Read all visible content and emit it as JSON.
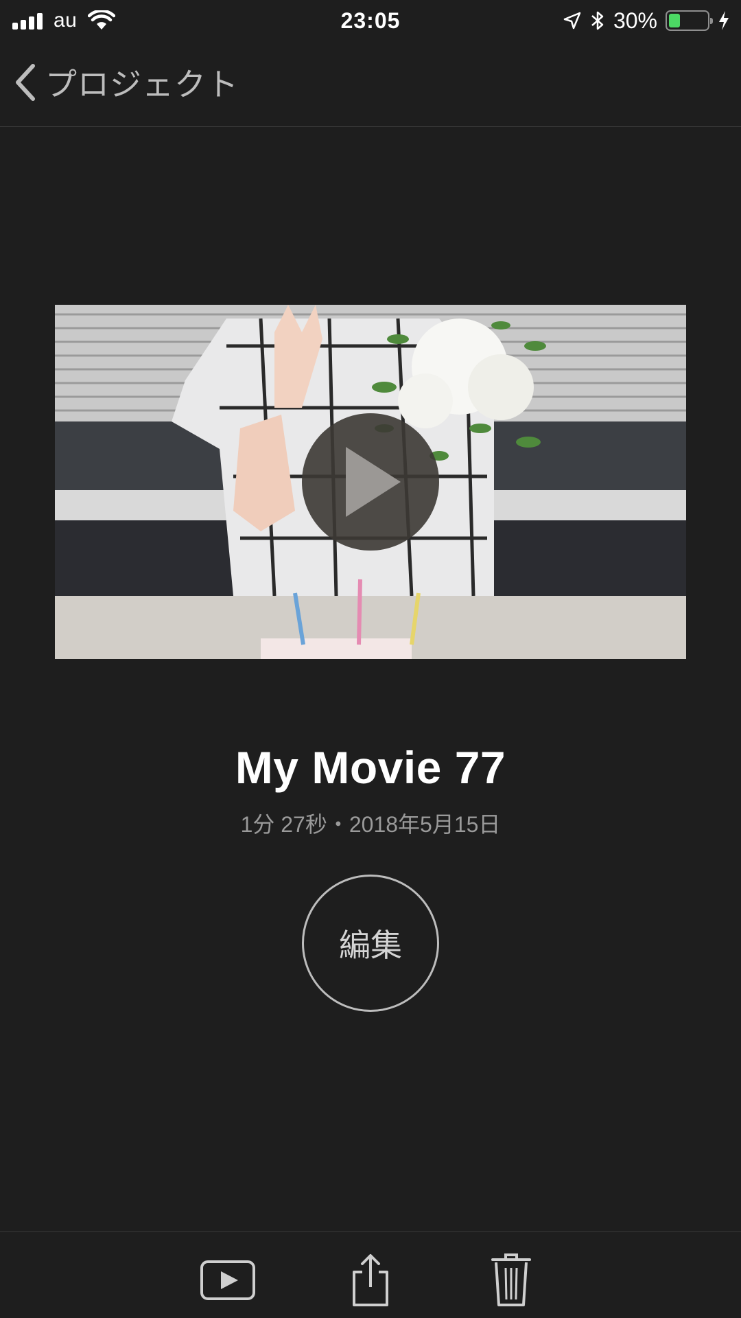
{
  "status_bar": {
    "carrier": "au",
    "time": "23:05",
    "battery_percent": "30%",
    "battery_level": 0.3,
    "icons": [
      "signal-bars-icon",
      "wifi-icon",
      "location-arrow-icon",
      "bluetooth-icon",
      "battery-icon",
      "charging-bolt-icon"
    ]
  },
  "nav": {
    "back_label": "プロジェクト",
    "back_icon": "chevron-left-icon"
  },
  "project": {
    "title": "My Movie 77",
    "meta": "1分 27秒・2018年5月15日",
    "edit_label": "編集",
    "play_icon": "play-icon"
  },
  "toolbar": {
    "icons": [
      "play-box-icon",
      "share-icon",
      "trash-icon"
    ]
  },
  "colors": {
    "background": "#1e1e1e",
    "battery_fill": "#4cd964",
    "secondary_text": "#9a9a9a"
  }
}
